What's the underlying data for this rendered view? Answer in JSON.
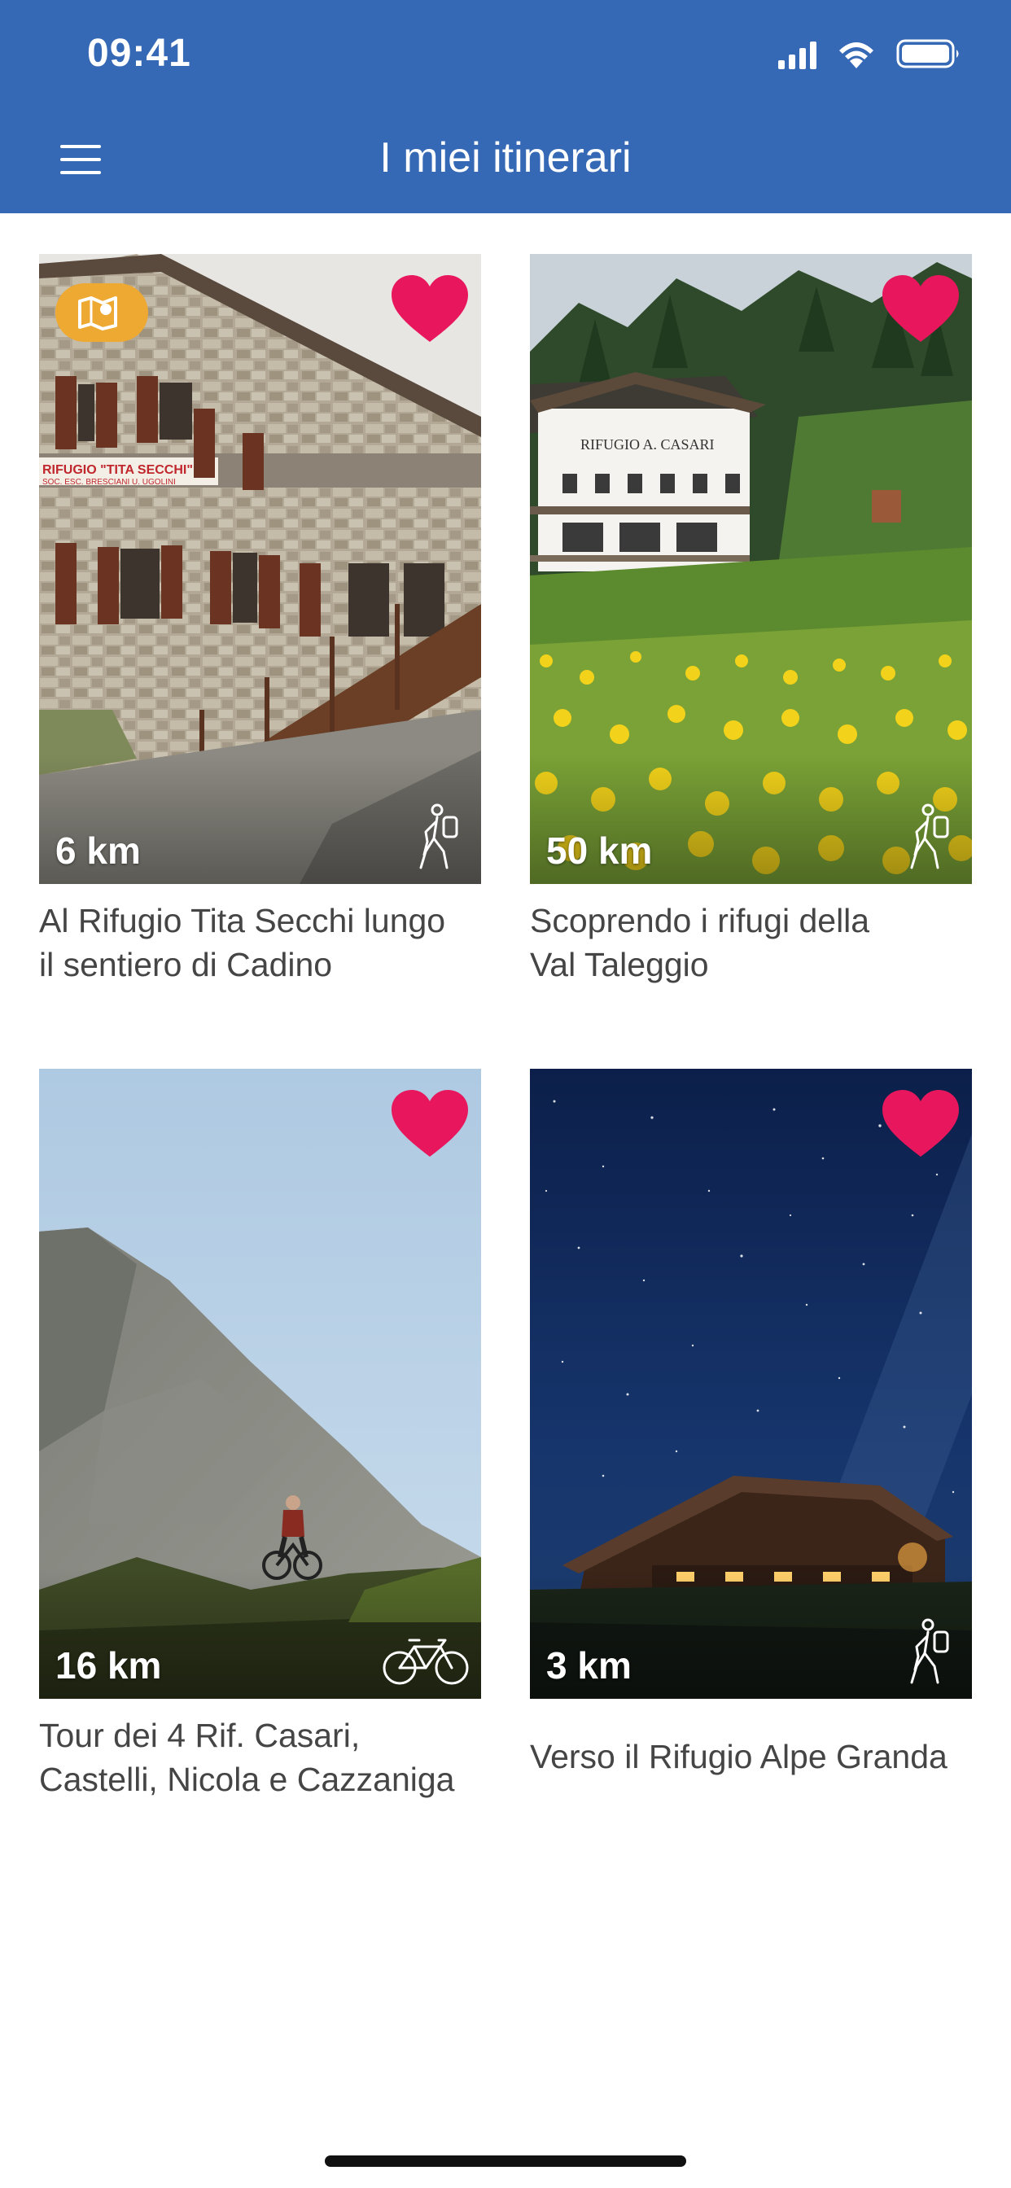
{
  "status_bar": {
    "time": "09:41"
  },
  "header": {
    "title": "I miei itinerari",
    "menu_icon": "hamburger-menu-icon",
    "background": "#3568b5"
  },
  "colors": {
    "heart": "#e8175d",
    "map_badge": "#eda932"
  },
  "itineraries": [
    {
      "distance": "6 km",
      "title_lines": [
        "Al Rifugio Tita Secchi lungo",
        "il sentiero di Cadino"
      ],
      "activity": "hiking-icon",
      "favorite": true,
      "badge": "map-icon",
      "sign_text": [
        "RIFUGIO \"TITA SECCHI\"",
        "SOC. ESC. BRESCIANI U. UGOLINI"
      ]
    },
    {
      "distance": "50 km",
      "title_lines": [
        "Scoprendo i rifugi della",
        "Val Taleggio"
      ],
      "activity": "hiking-icon",
      "favorite": true,
      "sign_text": [
        "RIFUGIO A. CASARI"
      ]
    },
    {
      "distance": "16 km",
      "title_lines": [
        "Tour dei 4 Rif. Casari,",
        "Castelli, Nicola e Cazzaniga"
      ],
      "activity": "bicycle-icon",
      "favorite": true
    },
    {
      "distance": "3 km",
      "title_lines": [
        "Verso il Rifugio Alpe Granda"
      ],
      "activity": "hiking-icon",
      "favorite": true
    }
  ]
}
